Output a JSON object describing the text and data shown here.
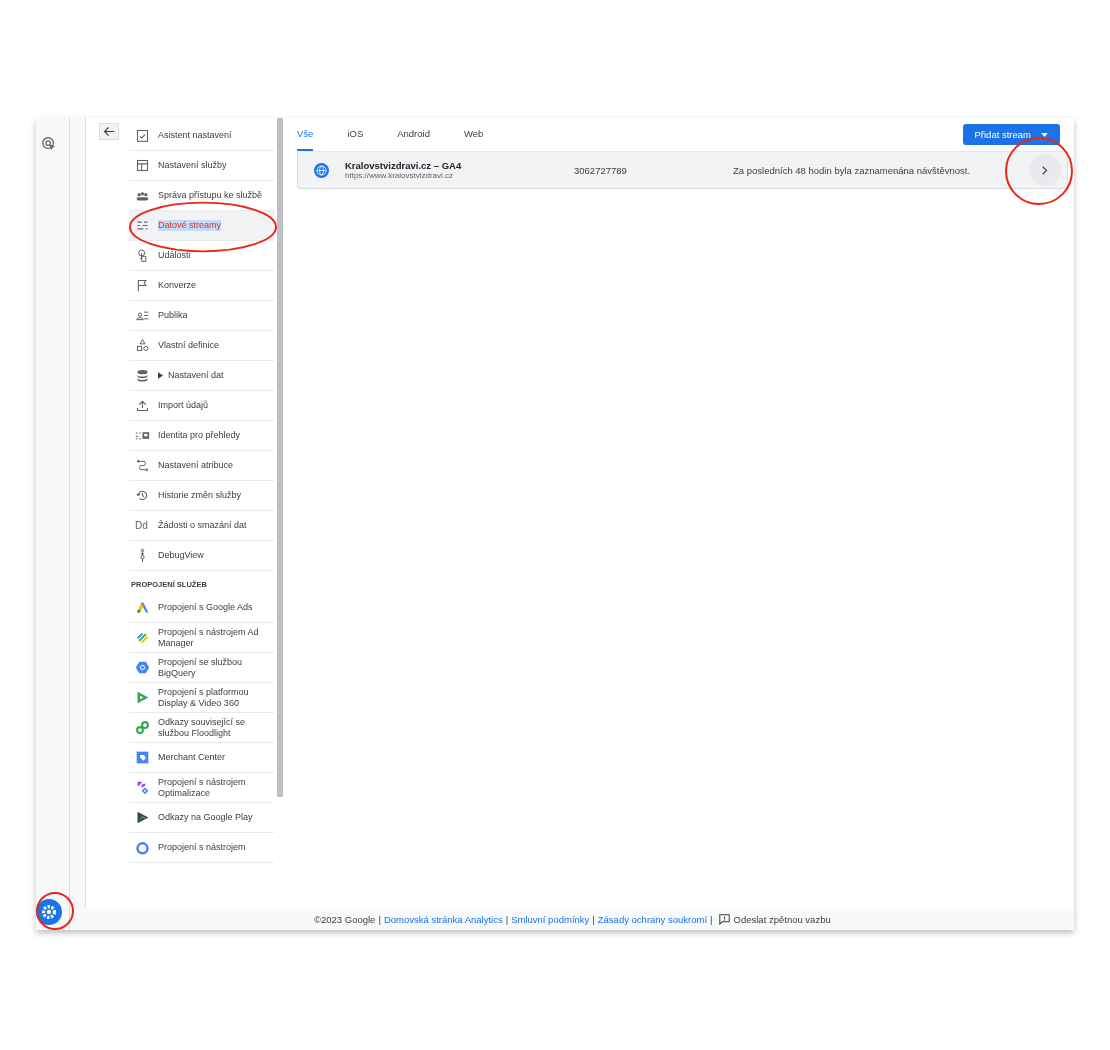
{
  "rail": {
    "items": [
      {
        "selected": false
      },
      {
        "selected": true
      }
    ]
  },
  "nav": {
    "items": [
      {
        "kind": "item",
        "label": "Asistent nastavení",
        "selected": false
      },
      {
        "kind": "item",
        "label": "Nastavení služby",
        "selected": false
      },
      {
        "kind": "item",
        "label": "Správa přístupu ke službě",
        "selected": false
      },
      {
        "kind": "item",
        "label": "Datové streamy",
        "selected": true
      },
      {
        "kind": "item",
        "label": "Události",
        "selected": false
      },
      {
        "kind": "item",
        "label": "Konverze",
        "selected": false
      },
      {
        "kind": "item",
        "label": "Publika",
        "selected": false
      },
      {
        "kind": "item",
        "label": "Vlastní definice",
        "selected": false
      },
      {
        "kind": "group",
        "label": "Nastavení dat",
        "selected": false,
        "expanded": false
      },
      {
        "kind": "item",
        "label": "Import údajů",
        "selected": false
      },
      {
        "kind": "item",
        "label": "Identita pro přehledy",
        "selected": false
      },
      {
        "kind": "item",
        "label": "Nastavení atribuce",
        "selected": false
      },
      {
        "kind": "item",
        "label": "Historie změn služby",
        "selected": false
      },
      {
        "kind": "item",
        "label": "Žádosti o smazání dat",
        "selected": false,
        "icon_text": "Dd"
      },
      {
        "kind": "item",
        "label": "DebugView",
        "selected": false
      },
      {
        "kind": "header",
        "label": "PROPOJENÍ SLUŽEB"
      },
      {
        "kind": "item",
        "label": "Propojení s Google Ads",
        "selected": false
      },
      {
        "kind": "item",
        "label": "Propojení s nástrojem Ad Manager",
        "selected": false
      },
      {
        "kind": "item",
        "label": "Propojení se službou BigQuery",
        "selected": false
      },
      {
        "kind": "item",
        "label": "Propojení s platformou Display & Video 360",
        "selected": false
      },
      {
        "kind": "item",
        "label": "Odkazy související se službou Floodlight",
        "selected": false
      },
      {
        "kind": "item",
        "label": "Merchant Center",
        "selected": false
      },
      {
        "kind": "item",
        "label": "Propojení s nástrojem Optimalizace",
        "selected": false
      },
      {
        "kind": "item",
        "label": "Odkazy na Google Play",
        "selected": false
      },
      {
        "kind": "item",
        "label": "Propojení s nástrojem",
        "selected": false
      }
    ]
  },
  "tabs": [
    {
      "label": "Vše",
      "selected": true
    },
    {
      "label": "iOS",
      "selected": false
    },
    {
      "label": "Android",
      "selected": false
    },
    {
      "label": "Web",
      "selected": false
    }
  ],
  "add_button": {
    "label": "Přidat stream"
  },
  "streams": [
    {
      "name": "Kralovstvizdravi.cz – GA4",
      "url": "https://www.kralovstvizdravi.cz",
      "id": "3062727789",
      "status": "Za posledních 48 hodin byla zaznamenána návštěvnost."
    }
  ],
  "footer": {
    "parts": [
      {
        "kind": "text",
        "text": "©2023 Google"
      },
      {
        "kind": "sep",
        "text": "|"
      },
      {
        "kind": "link",
        "text": "Domovská stránka Analytics"
      },
      {
        "kind": "sep",
        "text": "|"
      },
      {
        "kind": "link",
        "text": "Smluvní podmínky"
      },
      {
        "kind": "sep",
        "text": "|"
      },
      {
        "kind": "link",
        "text": "Zásady ochrany soukromí"
      },
      {
        "kind": "sep",
        "text": "|"
      },
      {
        "kind": "feedback",
        "text": "Odeslat zpětnou vazbu"
      }
    ]
  }
}
